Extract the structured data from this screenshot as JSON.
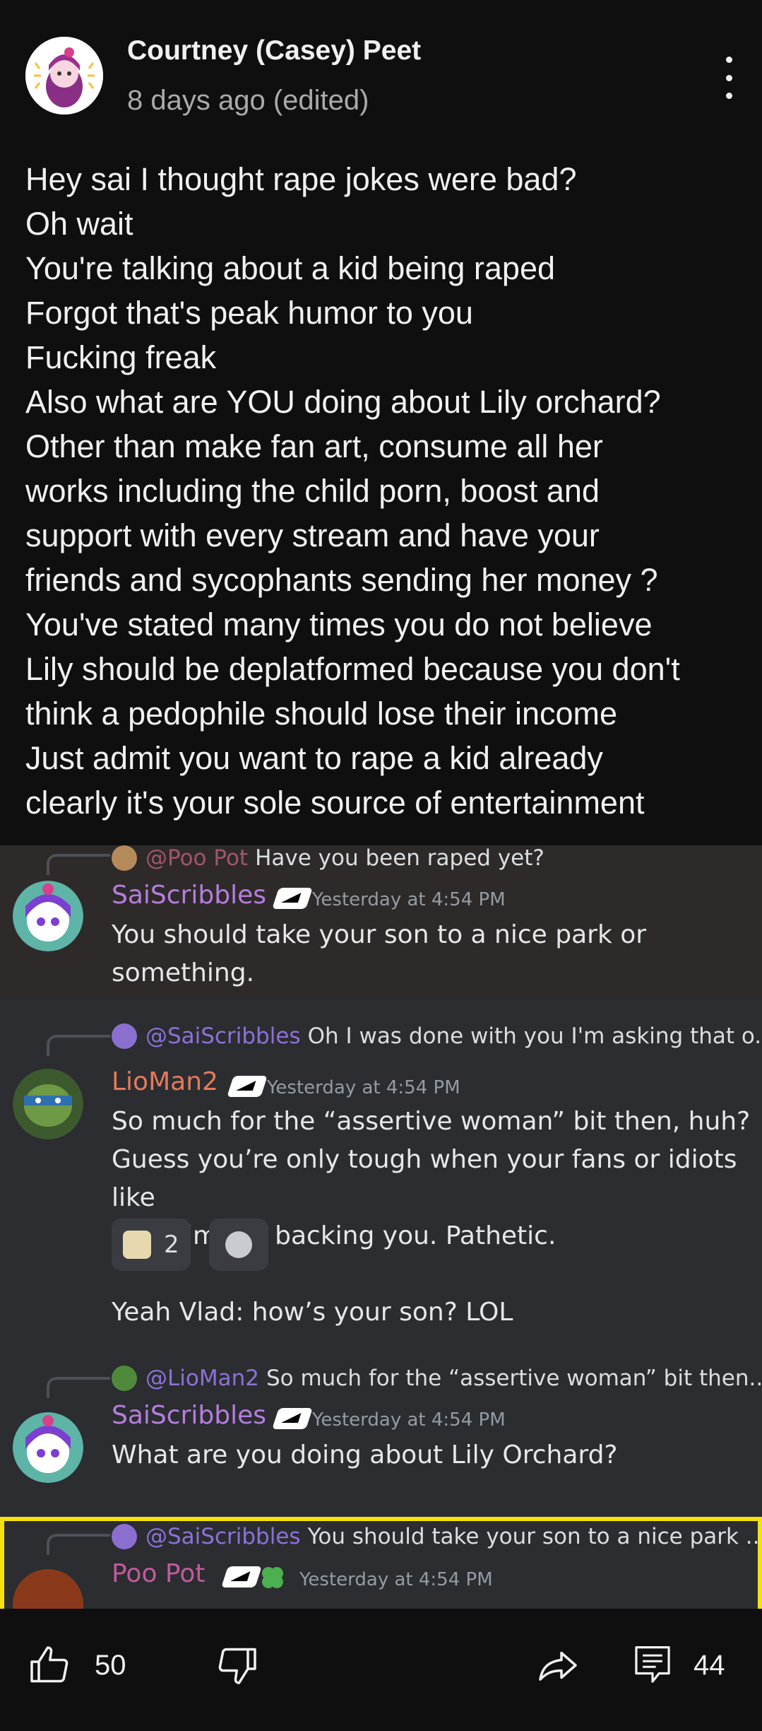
{
  "comment": {
    "author": "Courtney (Casey) Peet",
    "timestamp": "8 days ago (edited)",
    "lines": [
      "Hey sai I thought rape jokes were bad?",
      "Oh wait",
      "You're talking about a kid being raped",
      "Forgot that's peak humor to you",
      "Fucking freak",
      "Also what are YOU doing about Lily orchard?",
      "Other than make fan art, consume all her",
      "works including the child porn, boost and",
      "support with every stream and have your",
      "friends and sycophants sending her money ?",
      "You've stated many times you do not believe",
      "Lily should be deplatformed because you don't",
      "think a pedophile should lose their income",
      "Just admit you want to rape a kid already",
      "clearly it's your sole source of entertainment"
    ],
    "menu_icon": "more-vert-icon"
  },
  "embed": {
    "messages": [
      {
        "reply_mention": "@Poo Pot",
        "reply_text": "Have you been raped yet?",
        "username": "SaiScribbles",
        "time": "Yesterday at 4:54 PM",
        "text_lines": [
          "You should take your son to a nice park or",
          "something."
        ]
      },
      {
        "reply_mention": "@SaiScribbles",
        "reply_text": "Oh I was done with you I'm asking that o...",
        "username": "LioMan2",
        "time": "Yesterday at 4:54 PM",
        "text_lines": [
          "So much for the “assertive woman” bit then, huh?",
          "Guess you’re only tough when your fans or idiots like",
          "Malcolm are backing you. Pathetic."
        ],
        "reaction_count": "2",
        "followup": "Yeah Vlad: how’s your son? LOL"
      },
      {
        "reply_mention": "@LioMan2",
        "reply_text": "So much for the “assertive woman” bit then...",
        "username": "SaiScribbles",
        "time": "Yesterday at 4:54 PM",
        "text_lines": [
          "What are you doing about Lily Orchard?"
        ]
      },
      {
        "reply_mention": "@SaiScribbles",
        "reply_text": "You should take your son to a nice park ...",
        "username": "Poo Pot",
        "time": "Yesterday at 4:54 PM"
      }
    ]
  },
  "actions": {
    "like_count": "50",
    "reply_count": "44",
    "like_icon": "thumbs-up-icon",
    "dislike_icon": "thumbs-down-icon",
    "share_icon": "share-icon",
    "reply_icon": "comment-icon"
  },
  "colors": {
    "background": "#0f0f0f",
    "discord_bg": "#2b2d31",
    "highlight": "#f5e10c",
    "mention": "#8e71d6"
  }
}
